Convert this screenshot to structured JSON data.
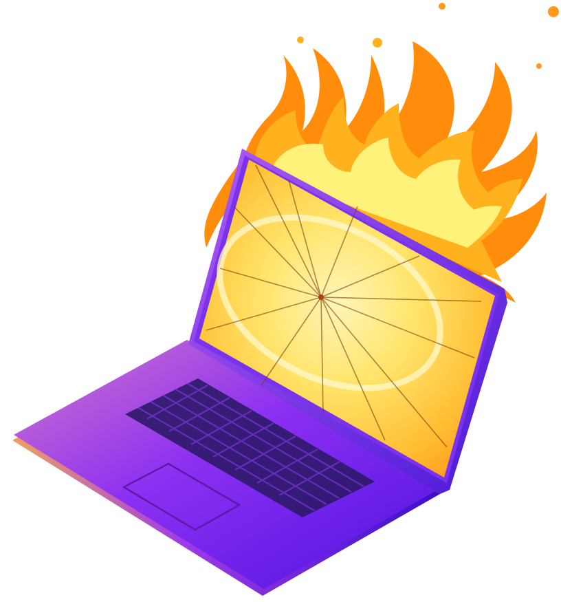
{
  "illustration": {
    "subject": "laptop-on-fire",
    "icons": [
      "flame-icon",
      "laptop-icon",
      "cracked-screen-icon",
      "keyboard-icon",
      "touchpad-icon"
    ],
    "colors": {
      "background": "#ffffff",
      "flame_outer": "#ff8c0a",
      "flame_mid": "#ffb21e",
      "flame_inner": "#fff27a",
      "body_light": "#c46ad8",
      "body_mid": "#8a2cf0",
      "body_dark": "#5214e6",
      "rim": "#6a1fe0",
      "bezel": "#7a32ec",
      "keys": "#2f1a6b",
      "screen_glow": "#fff3a0",
      "screen_edge": "#ff9a1c",
      "crack": "#7a3c10"
    }
  }
}
